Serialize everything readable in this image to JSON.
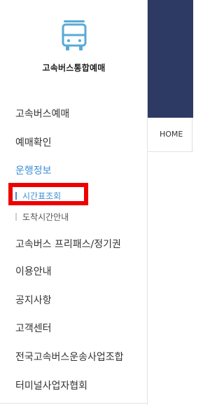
{
  "logo": {
    "icon": "bus-icon",
    "text": "고속버스통합예매",
    "color": "#5aa9d6"
  },
  "menu": [
    {
      "label": "고속버스예매"
    },
    {
      "label": "예매확인"
    },
    {
      "label": "운행정보",
      "active": true
    },
    {
      "label": "고속버스 프리패스/정기권"
    },
    {
      "label": "이용안내"
    },
    {
      "label": "공지사항"
    },
    {
      "label": "고객센터"
    },
    {
      "label": "전국고속버스운송사업조합"
    },
    {
      "label": "터미널사업자협회"
    }
  ],
  "submenu": [
    {
      "label": "시간표조회",
      "current": true
    },
    {
      "label": "도착시간안내"
    }
  ],
  "breadcrumb": {
    "home": "HOME"
  },
  "colors": {
    "accent": "#3d8fd6",
    "header": "#2d3a64",
    "highlight": "#ee0000"
  }
}
